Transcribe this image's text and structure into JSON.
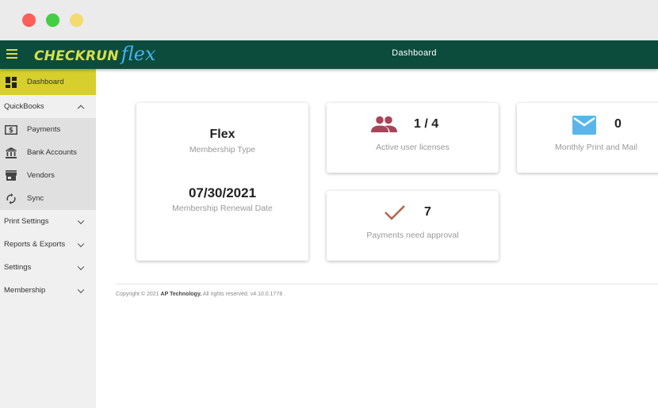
{
  "window": {
    "controls": [
      "close",
      "zoom",
      "minimize"
    ]
  },
  "header": {
    "brand_bold": "CHECKRUN",
    "brand_script": "flex",
    "title": "Dashboard"
  },
  "sidebar": {
    "items": [
      {
        "label": "Dashboard",
        "icon": "dashboard-icon",
        "active": true
      },
      {
        "label": "QuickBooks",
        "expanded": true
      },
      {
        "label": "Payments",
        "icon": "dollar-icon"
      },
      {
        "label": "Bank Accounts",
        "icon": "bank-icon"
      },
      {
        "label": "Vendors",
        "icon": "store-icon"
      },
      {
        "label": "Sync",
        "icon": "sync-icon"
      },
      {
        "label": "Print Settings",
        "expanded": false
      },
      {
        "label": "Reports & Exports",
        "expanded": false
      },
      {
        "label": "Settings",
        "expanded": false
      },
      {
        "label": "Membership",
        "expanded": false
      }
    ]
  },
  "cards": {
    "membership": {
      "type_value": "Flex",
      "type_label": "Membership Type",
      "renewal_value": "07/30/2021",
      "renewal_label": "Membership Renewal Date"
    },
    "users": {
      "value": "1 / 4",
      "label": "Active user licenses",
      "icon": "users-icon"
    },
    "mail": {
      "value": "0",
      "label": "Monthly Print and Mail",
      "icon": "mail-icon"
    },
    "payments": {
      "value": "7",
      "label": "Payments need approval",
      "icon": "check-icon"
    }
  },
  "footer": {
    "prefix": "Copyright © 2021",
    "company": "AP Technology.",
    "suffix": "All rights reserved. v4.10.0.1778 ."
  },
  "colors": {
    "header_bg": "#0c4c3d",
    "brand_yellow": "#d6e04a",
    "brand_blue": "#46b2ee",
    "active_nav": "#d6cf2c",
    "users_icon": "#a8445a",
    "mail_icon": "#5ab6ea",
    "check_icon": "#b5694f"
  }
}
